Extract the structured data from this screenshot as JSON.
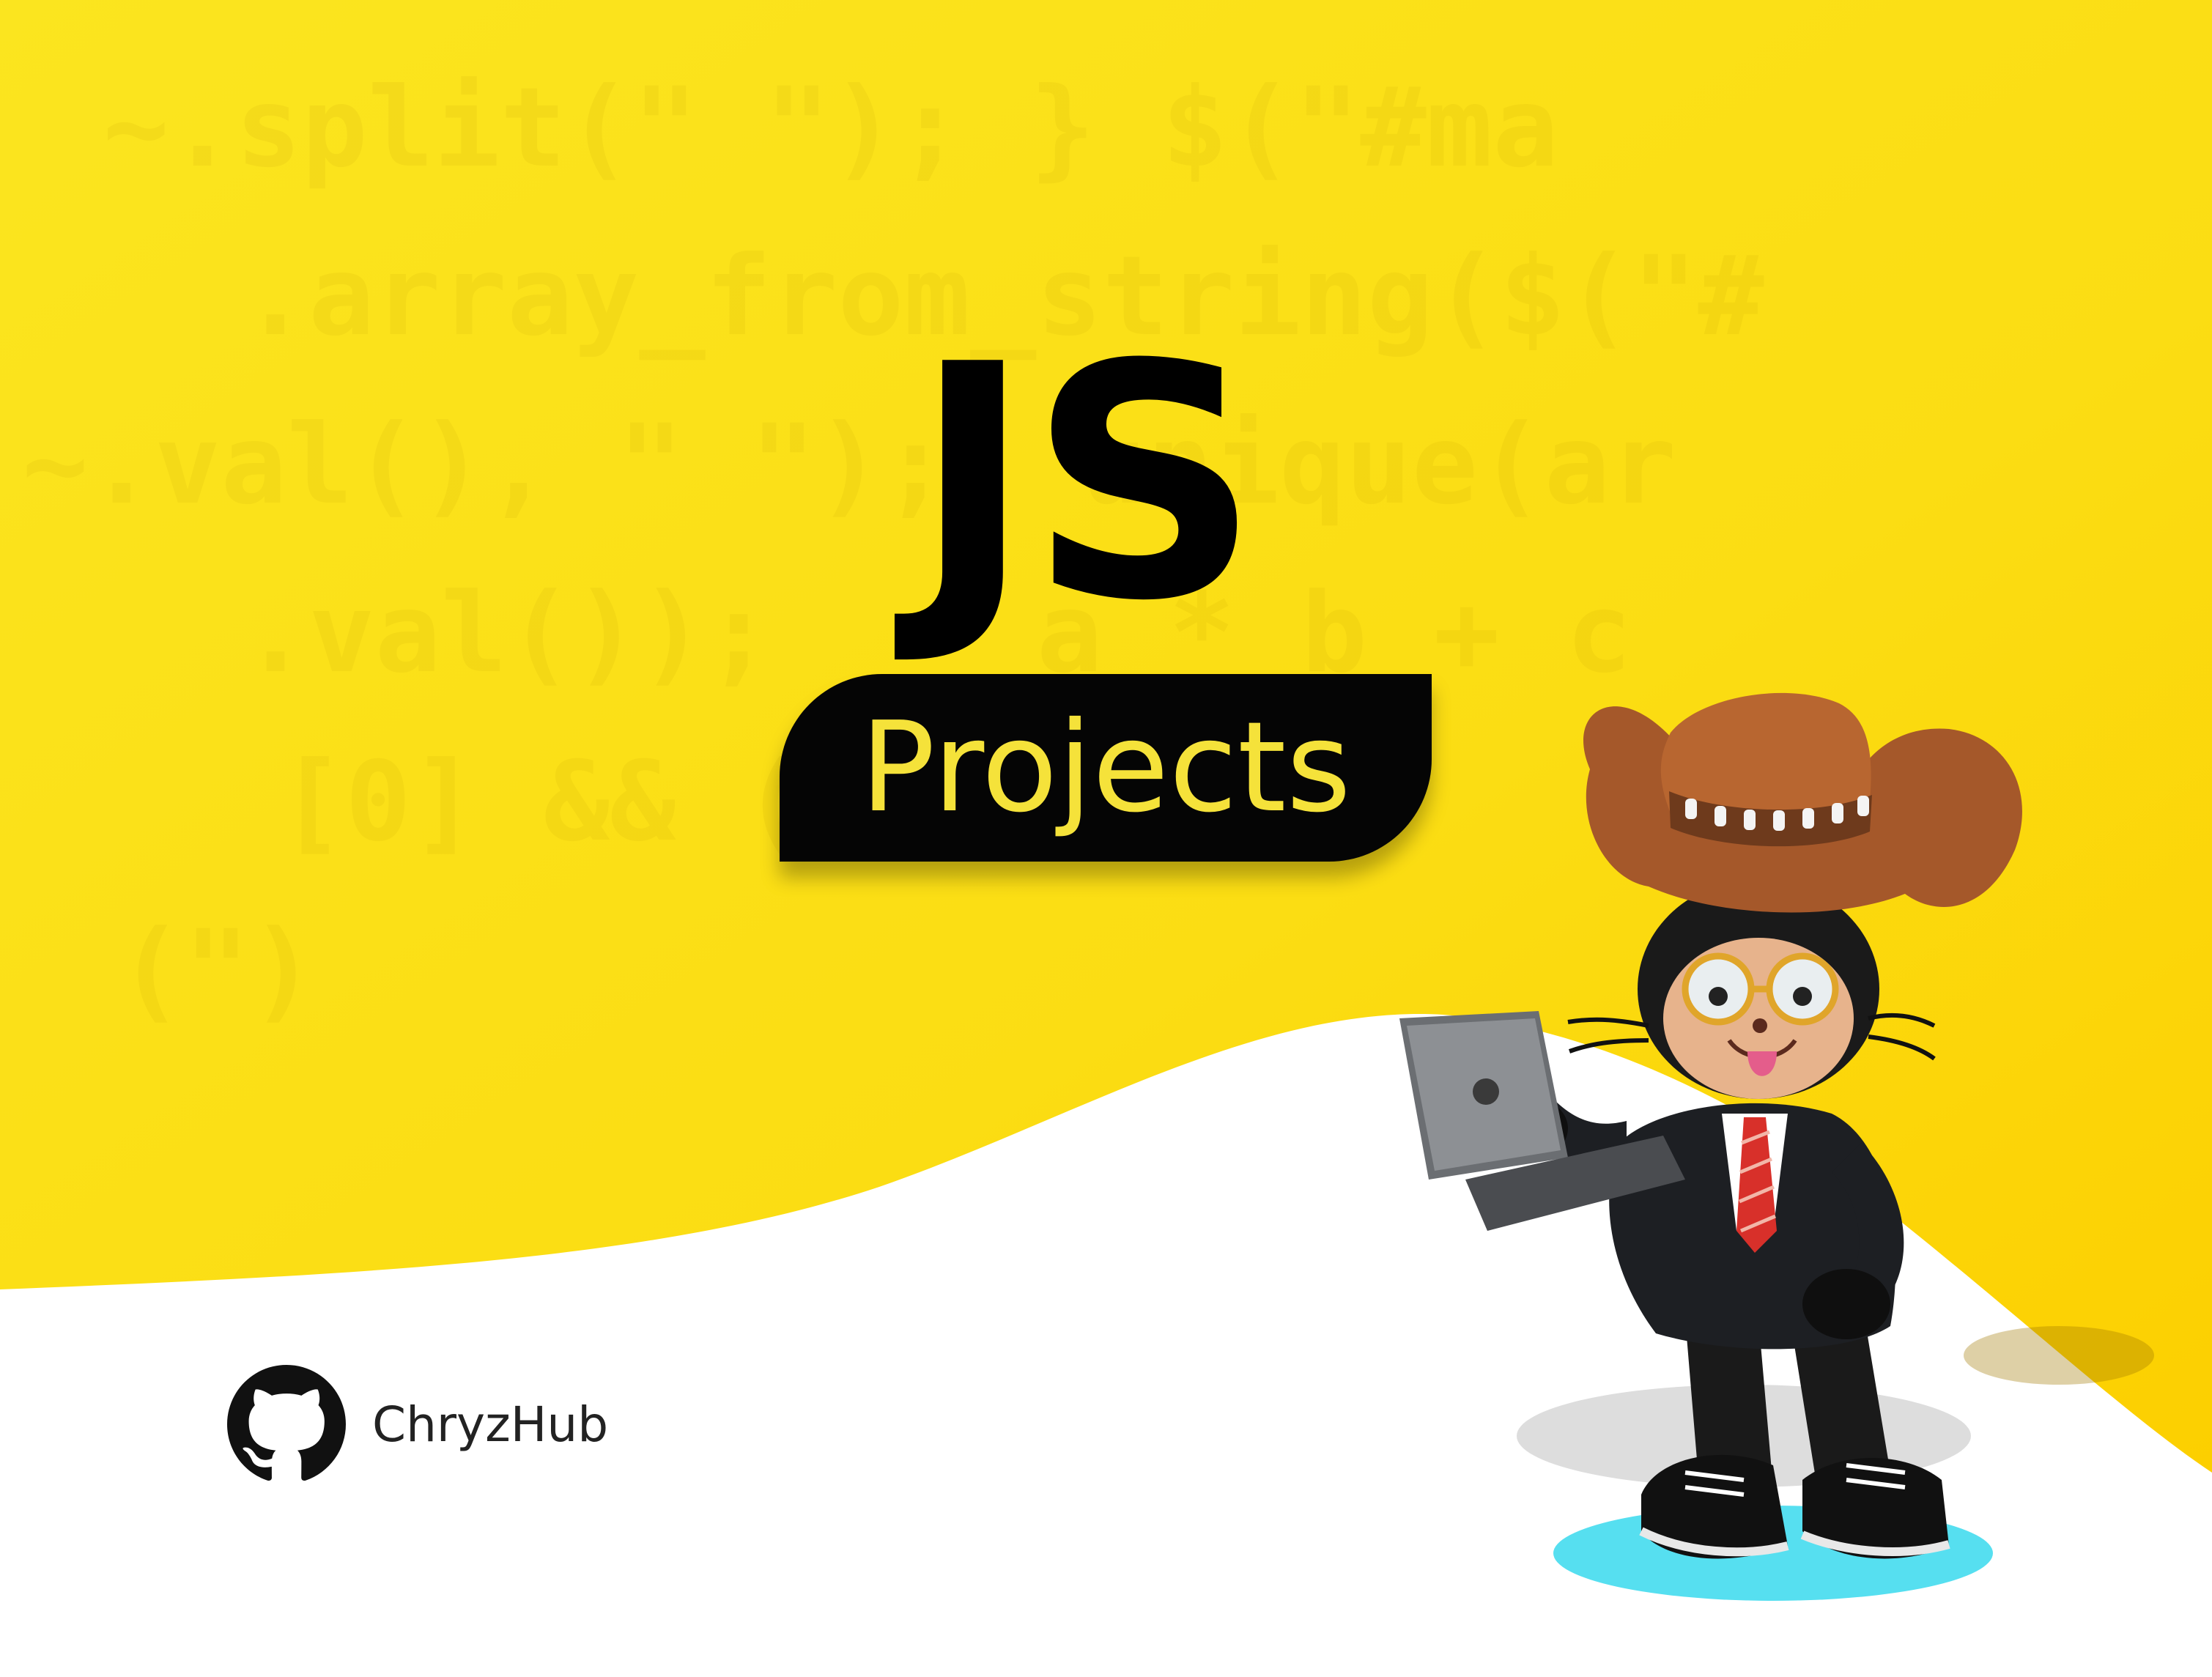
{
  "title": "JS",
  "badge": "Projects",
  "brand": {
    "name": "ChryzHub",
    "icon": "github-octocat-icon"
  },
  "background": {
    "code_lines": [
      "  ~.split(\" \"); } $(\"#ma",
      "  .array_from_string($(\"#",
      " ~.val(), \" \");  unique(ar",
      "   .val());    a * b + c",
      "  [0] && ( !",
      "  (\")"
    ]
  },
  "colors": {
    "yellow_top": "#fbe120",
    "yellow_right": "#fcd100",
    "badge_bg": "#050505",
    "badge_text": "#f5e23a",
    "title": "#000000",
    "white": "#ffffff"
  },
  "mascot": "octocat-cowboy-illustration"
}
